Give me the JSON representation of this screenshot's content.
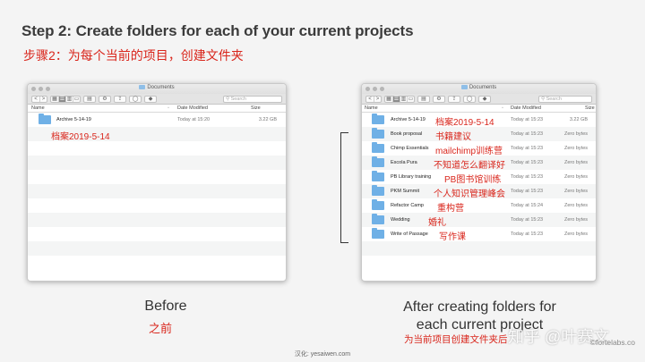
{
  "slide": {
    "title": "Step 2: Create folders for each of your current projects",
    "subtitle_cn": "步骤2：为每个当前的项目，创建文件夹"
  },
  "finder_common": {
    "window_title": "Documents",
    "search_placeholder": "Search",
    "back": "<",
    "forward": ">",
    "col_name": "Name",
    "col_date": "Date Modified",
    "col_size": "Size",
    "sort_arrow": "^"
  },
  "left_window": {
    "rows": [
      {
        "name": "Archive 5-14-19",
        "date": "Today at 15:20",
        "size": "3.22 GB"
      },
      {
        "name": "",
        "date": "",
        "size": ""
      },
      {
        "name": "",
        "date": "",
        "size": ""
      },
      {
        "name": "",
        "date": "",
        "size": ""
      },
      {
        "name": "",
        "date": "",
        "size": ""
      },
      {
        "name": "",
        "date": "",
        "size": ""
      },
      {
        "name": "",
        "date": "",
        "size": ""
      },
      {
        "name": "",
        "date": "",
        "size": ""
      },
      {
        "name": "",
        "date": "",
        "size": ""
      },
      {
        "name": "",
        "date": "",
        "size": ""
      },
      {
        "name": "",
        "date": "",
        "size": ""
      }
    ],
    "annotation_cn": "档案2019-5-14"
  },
  "right_window": {
    "rows": [
      {
        "name": "Archive 5-14-19",
        "date": "Today at 15:23",
        "size": "3.22 GB",
        "cn": "档案2019-5-14"
      },
      {
        "name": "Book proposal",
        "date": "Today at 15:23",
        "size": "Zero bytes",
        "cn": "书籍建议"
      },
      {
        "name": "Chimp Essentials",
        "date": "Today at 15:23",
        "size": "Zero bytes",
        "cn": "mailchimp训练营"
      },
      {
        "name": "Escola Pura",
        "date": "Today at 15:23",
        "size": "Zero bytes",
        "cn": "不知道怎么翻译好"
      },
      {
        "name": "PB Library training",
        "date": "Today at 15:23",
        "size": "Zero bytes",
        "cn": "PB图书馆训练"
      },
      {
        "name": "PKM Summit",
        "date": "Today at 15:23",
        "size": "Zero bytes",
        "cn": "个人知识管理峰会"
      },
      {
        "name": "Refactor Camp",
        "date": "Today at 15:24",
        "size": "Zero bytes",
        "cn": "重构营"
      },
      {
        "name": "Wedding",
        "date": "Today at 15:23",
        "size": "Zero bytes",
        "cn": "婚礼"
      },
      {
        "name": "Write of Passage",
        "date": "Today at 15:23",
        "size": "Zero bytes",
        "cn": "写作课"
      },
      {
        "name": "",
        "date": "",
        "size": "",
        "cn": ""
      },
      {
        "name": "",
        "date": "",
        "size": "",
        "cn": ""
      }
    ]
  },
  "captions": {
    "before": "Before",
    "before_cn": "之前",
    "after_line1": "After creating folders for",
    "after_line2": "each current project",
    "after_cn": "为当前项目创建文件夹后"
  },
  "footer": {
    "translator": "汉化: yesaiwen.com",
    "watermark": "知乎 @叶赛文",
    "credit": "©fortelabs.co"
  }
}
